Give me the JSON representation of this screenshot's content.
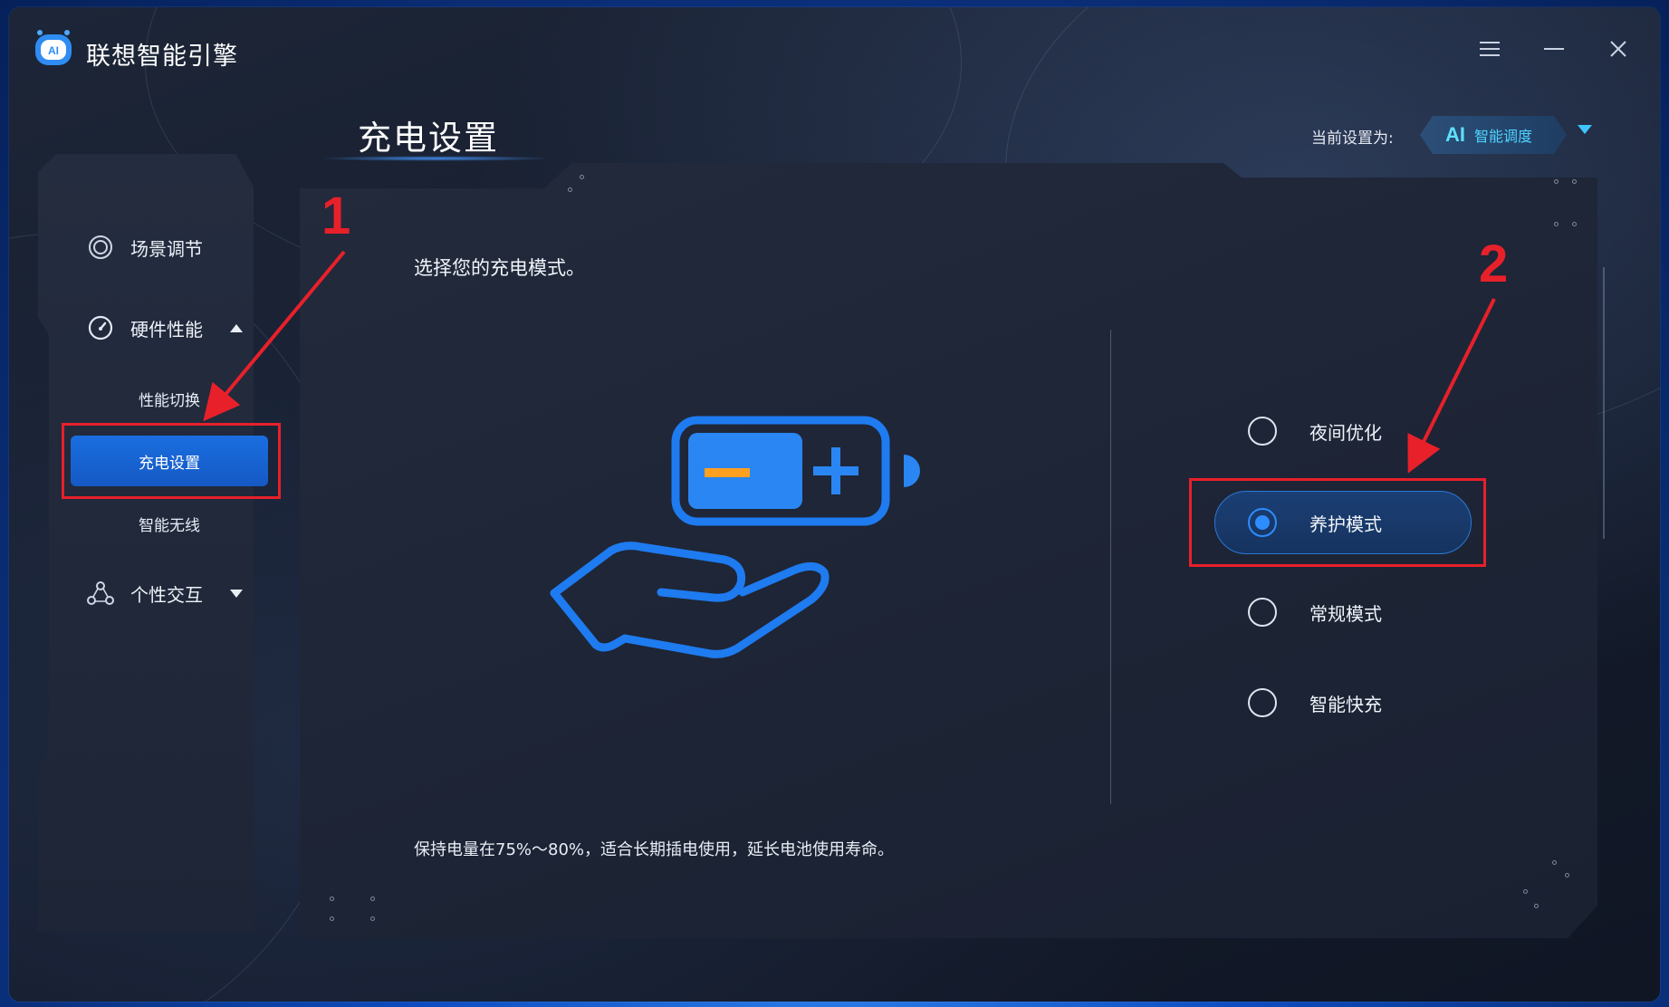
{
  "app": {
    "title": "联想智能引擎"
  },
  "page": {
    "heading": "充电设置"
  },
  "current_setting": {
    "label": "当前设置为:",
    "badge_ai": "AI",
    "badge_mode": "智能调度"
  },
  "sidebar": {
    "items": [
      {
        "label": "场景调节",
        "icon": "target-icon"
      },
      {
        "label": "硬件性能",
        "icon": "gauge-icon",
        "expanded": true
      },
      {
        "label": "个性交互",
        "icon": "network-icon",
        "expanded": false
      }
    ],
    "sub_items": [
      {
        "label": "性能切换"
      },
      {
        "label": "充电设置",
        "active": true
      },
      {
        "label": "智能无线"
      }
    ]
  },
  "main": {
    "prompt": "选择您的充电模式。",
    "modes": [
      {
        "label": "夜间优化",
        "selected": false
      },
      {
        "label": "养护模式",
        "selected": true
      },
      {
        "label": "常规模式",
        "selected": false
      },
      {
        "label": "智能快充",
        "selected": false
      }
    ],
    "description": "保持电量在75%～80%，适合长期插电使用，延长电池使用寿命。"
  },
  "annotations": {
    "step1": "1",
    "step2": "2"
  },
  "colors": {
    "accent_blue": "#1a6ee0",
    "annotation_red": "#e8202a",
    "badge_cyan": "#4fd4ff",
    "battery_orange": "#ffa020"
  }
}
